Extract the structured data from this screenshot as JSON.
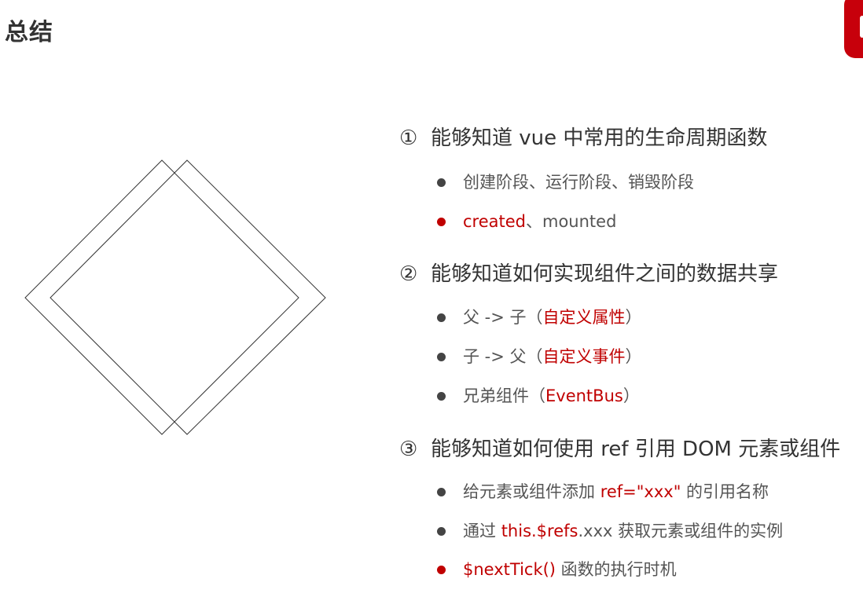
{
  "title": "总结",
  "sections": [
    {
      "number": "①",
      "heading": "能够知道 vue 中常用的生命周期函数",
      "bullets": [
        {
          "segments": [
            {
              "text": "创建阶段、运行阶段、销毁阶段",
              "red": false
            }
          ],
          "dot_red": false
        },
        {
          "segments": [
            {
              "text": "created",
              "red": true
            },
            {
              "text": "、mounted",
              "red": false
            }
          ],
          "dot_red": true
        }
      ]
    },
    {
      "number": "②",
      "heading": "能够知道如何实现组件之间的数据共享",
      "bullets": [
        {
          "segments": [
            {
              "text": "父 -> 子（",
              "red": false
            },
            {
              "text": "自定义属性",
              "red": true
            },
            {
              "text": "）",
              "red": false
            }
          ],
          "dot_red": false
        },
        {
          "segments": [
            {
              "text": "子 -> 父（",
              "red": false
            },
            {
              "text": "自定义事件",
              "red": true
            },
            {
              "text": "）",
              "red": false
            }
          ],
          "dot_red": false
        },
        {
          "segments": [
            {
              "text": "兄弟组件（",
              "red": false
            },
            {
              "text": "EventBus",
              "red": true
            },
            {
              "text": "）",
              "red": false
            }
          ],
          "dot_red": false
        }
      ]
    },
    {
      "number": "③",
      "heading": "能够知道如何使用 ref 引用 DOM 元素或组件",
      "bullets": [
        {
          "segments": [
            {
              "text": "给元素或组件添加 ",
              "red": false
            },
            {
              "text": "ref=\"xxx\"",
              "red": true
            },
            {
              "text": " 的引用名称",
              "red": false
            }
          ],
          "dot_red": false
        },
        {
          "segments": [
            {
              "text": "通过 ",
              "red": false
            },
            {
              "text": "this.$refs",
              "red": true
            },
            {
              "text": ".xxx 获取元素或组件的实例",
              "red": false
            }
          ],
          "dot_red": false
        },
        {
          "segments": [
            {
              "text": "$nextTick()",
              "red": true
            },
            {
              "text": " 函数的执行时机",
              "red": false
            }
          ],
          "dot_red": true
        }
      ]
    }
  ],
  "colors": {
    "accent": "#c00000",
    "badge": "#c7000b",
    "text": "#333333"
  }
}
